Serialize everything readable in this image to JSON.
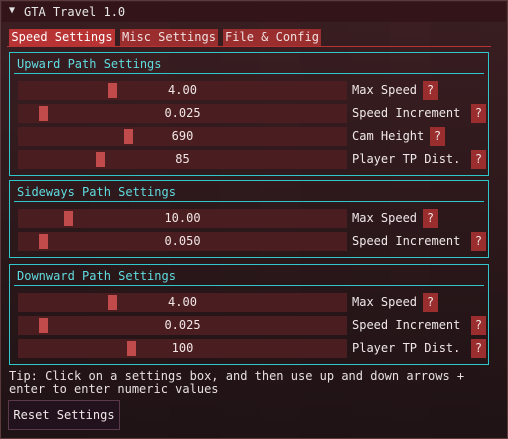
{
  "window": {
    "title": "GTA Travel 1.0",
    "collapse_icon": "triangle-down-icon"
  },
  "tabs": [
    {
      "label": "Speed Settings",
      "active": true
    },
    {
      "label": "Misc Settings",
      "active": false
    },
    {
      "label": "File & Config",
      "active": false
    }
  ],
  "groups": {
    "upward": {
      "title": "Upward Path Settings",
      "rows": [
        {
          "value": "4.00",
          "label": "Max Speed",
          "help": "?",
          "fraction": 0.28
        },
        {
          "value": "0.025",
          "label": "Speed Increment",
          "help": "?",
          "fraction": 0.06
        },
        {
          "value": "690",
          "label": "Cam Height",
          "help": "?",
          "fraction": 0.33
        },
        {
          "value": "85",
          "label": "Player TP Dist.",
          "help": "?",
          "fraction": 0.24
        }
      ]
    },
    "sideways": {
      "title": "Sideways Path Settings",
      "rows": [
        {
          "value": "10.00",
          "label": "Max Speed",
          "help": "?",
          "fraction": 0.14
        },
        {
          "value": "0.050",
          "label": "Speed Increment",
          "help": "?",
          "fraction": 0.06
        }
      ]
    },
    "downward": {
      "title": "Downward Path Settings",
      "rows": [
        {
          "value": "4.00",
          "label": "Max Speed",
          "help": "?",
          "fraction": 0.28
        },
        {
          "value": "0.025",
          "label": "Speed Increment",
          "help": "?",
          "fraction": 0.06
        },
        {
          "value": "100",
          "label": "Player TP Dist.",
          "help": "?",
          "fraction": 0.34
        }
      ]
    }
  },
  "tip": "Tip: Click on a settings box, and then use up and down arrows + enter to enter numeric values",
  "reset_label": "Reset Settings",
  "colors": {
    "accent": "#b83434",
    "frame": "#2fc6cc",
    "slider_bg": "#4a1e20",
    "grab": "#c14a4a"
  }
}
